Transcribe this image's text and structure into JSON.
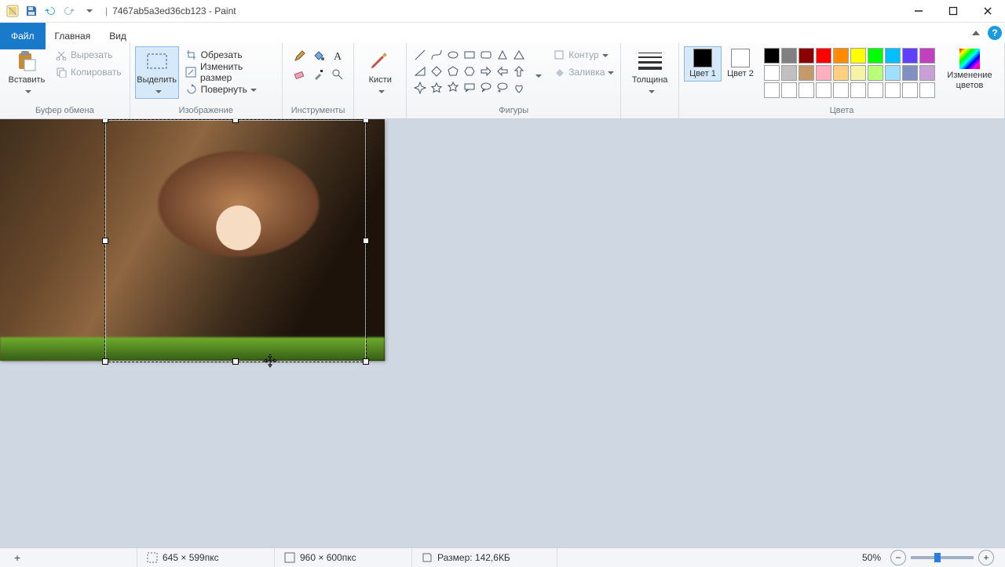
{
  "title_bar": {
    "doc_title": "7467ab5a3ed36cb123 - Paint"
  },
  "tabs": {
    "file": "Файл",
    "home": "Главная",
    "view": "Вид"
  },
  "ribbon": {
    "clipboard": {
      "paste": "Вставить",
      "cut": "Вырезать",
      "copy": "Копировать",
      "label": "Буфер обмена"
    },
    "image": {
      "select": "Выделить",
      "crop": "Обрезать",
      "resize": "Изменить размер",
      "rotate": "Повернуть",
      "label": "Изображение"
    },
    "tools": {
      "label": "Инструменты"
    },
    "brushes": {
      "title": "Кисти"
    },
    "shapes": {
      "outline": "Контур",
      "fill": "Заливка",
      "label": "Фигуры"
    },
    "thickness": {
      "title": "Толщина"
    },
    "colors": {
      "color1": "Цвет 1",
      "color2": "Цвет 2",
      "edit": "Изменение цветов",
      "label": "Цвета",
      "row1": [
        "#000000",
        "#808080",
        "#8b0000",
        "#ff0000",
        "#ff8c00",
        "#ffff00",
        "#00ff00",
        "#00c0ff",
        "#6040ff",
        "#c040c0"
      ],
      "row2": [
        "#ffffff",
        "#c0c0c0",
        "#c49a6c",
        "#ffb0c0",
        "#ffd080",
        "#f5f3a5",
        "#b8ff7a",
        "#a0e0ff",
        "#8090c0",
        "#c9a0d6"
      ],
      "row3": [
        "#ffffff",
        "#ffffff",
        "#ffffff",
        "#ffffff",
        "#ffffff",
        "#ffffff",
        "#ffffff",
        "#ffffff",
        "#ffffff",
        "#ffffff"
      ]
    }
  },
  "status": {
    "selection_size": "645 × 599пкс",
    "canvas_size": "960 × 600пкс",
    "file_size": "Размер: 142,6КБ",
    "zoom": "50%"
  }
}
